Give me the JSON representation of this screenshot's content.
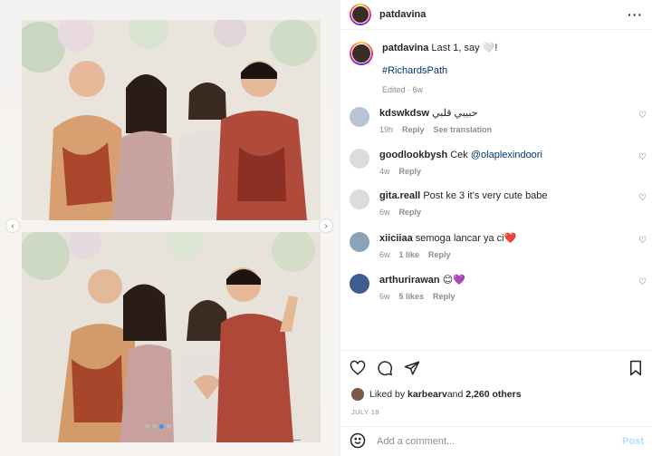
{
  "post": {
    "username": "patdavina",
    "caption_text": "Last 1, say 🤍!",
    "hashtag": "#RichardsPath",
    "edited": "Edited · 6w"
  },
  "comments": [
    {
      "username": "kdswkdsw",
      "text": "حبيبي قلبي",
      "time": "19h",
      "likes": "",
      "reply": "Reply",
      "extra": "See translation",
      "avatar_color": "#b9c3d6"
    },
    {
      "username": "goodlookbysh",
      "text": "Cek ",
      "mention": "@olaplexindoori",
      "time": "4w",
      "likes": "",
      "reply": "Reply",
      "extra": "",
      "avatar_color": "#dcdcdc"
    },
    {
      "username": "gita.reall",
      "text": "Post ke 3 it's very cute babe",
      "time": "6w",
      "likes": "",
      "reply": "Reply",
      "extra": "",
      "avatar_color": "#dcdcdc"
    },
    {
      "username": "xiiciiaa",
      "text": "semoga lancar ya ci❤️",
      "time": "6w",
      "likes": "1 like",
      "reply": "Reply",
      "extra": "",
      "avatar_color": "#8aa3b8"
    },
    {
      "username": "arthurirawan",
      "text": "😊💜",
      "time": "6w",
      "likes": "5 likes",
      "reply": "Reply",
      "extra": "",
      "avatar_color": "#3d5d8f"
    }
  ],
  "engagement": {
    "liked_by_prefix": "Liked by ",
    "liked_by_user": "karbearv",
    "liked_by_suffix": " and ",
    "others": "2,260 others",
    "date": "JULY 18"
  },
  "composer": {
    "placeholder": "Add a comment...",
    "post_label": "Post"
  },
  "icons": [
    "more-icon",
    "heart-icon",
    "comment-icon",
    "share-icon",
    "save-icon",
    "emoji-icon",
    "chevron-left-icon",
    "chevron-right-icon"
  ],
  "colors": {
    "link": "#00376b",
    "meta": "#8e8e8e",
    "post_button": "#b2dffc",
    "carousel_active": "#3897f0"
  }
}
